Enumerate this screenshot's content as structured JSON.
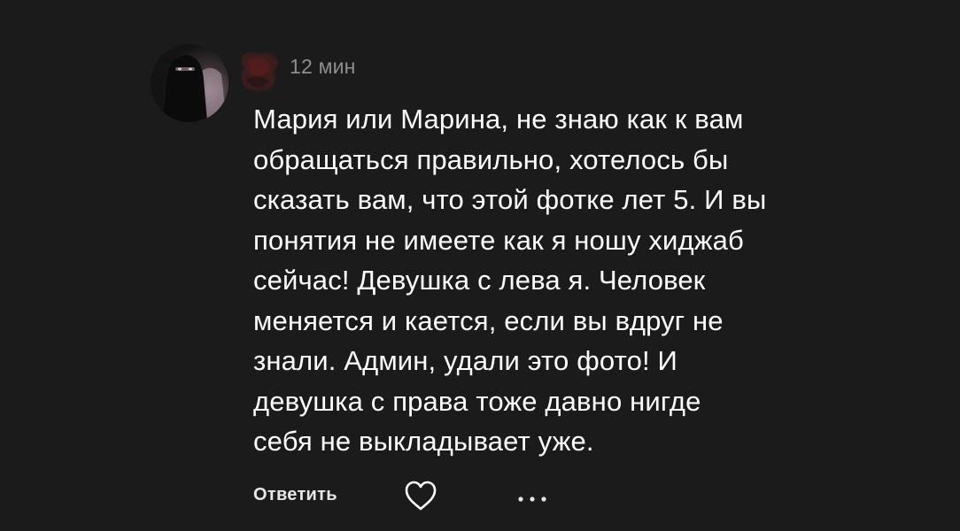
{
  "comment": {
    "timestamp": "12 мин",
    "text_lines": [
      "Мария или Марина, не знаю как к вам",
      "обращаться правильно, хотелось бы",
      "сказать вам, что этой фотке лет 5. И вы",
      "понятия не имеете как я ношу хиджаб",
      "сейчас! Девушка с лева я. Человек",
      "меняется и кается, если вы вдруг не",
      "знали. Админ, удали это фото! И",
      "девушка с права тоже давно нигде",
      "себя не выкладывает уже."
    ]
  },
  "actions": {
    "reply_label": "Ответить",
    "like_icon": "heart-outline-icon",
    "more_icon": "more-dots-icon"
  },
  "colors": {
    "background": "#1b1b1b",
    "text": "#ffffff",
    "muted": "#8e8e8e"
  }
}
